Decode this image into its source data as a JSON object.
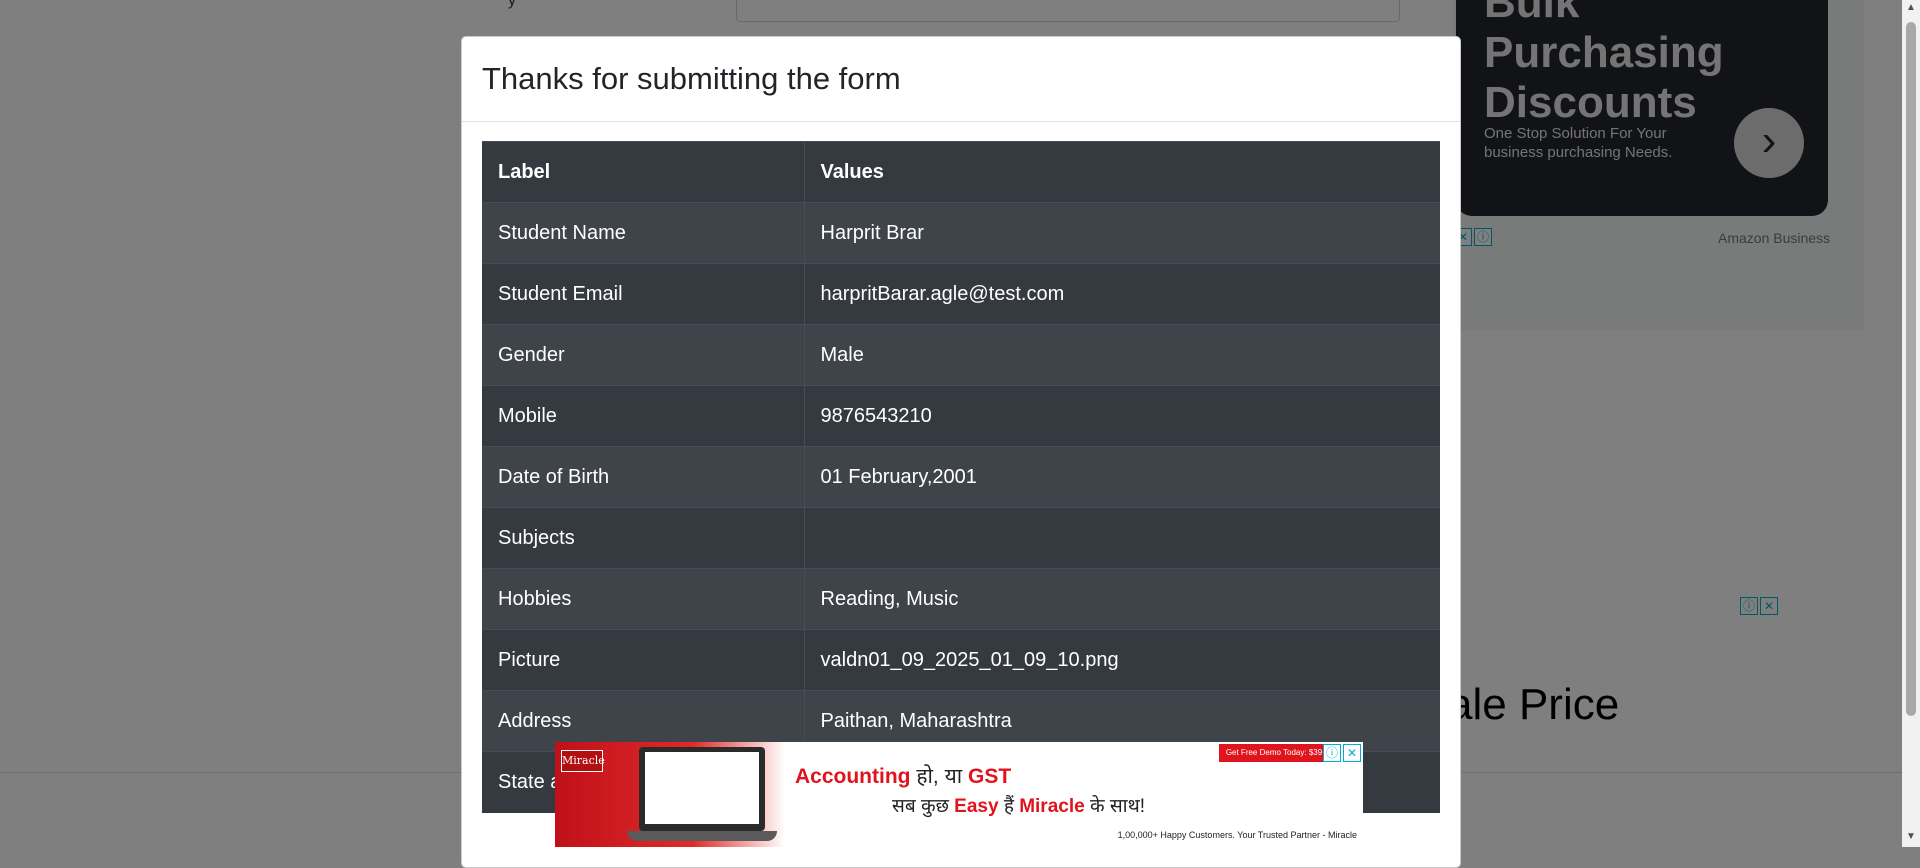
{
  "background": {
    "label_fragment": "y",
    "sale_banner": "ale Price",
    "ad_icons": [
      "ⓘ",
      "✕"
    ]
  },
  "amazon_ad": {
    "headline": "Bulk Purchasing Discounts",
    "subtext": "One Stop Solution For Your business purchasing Needs.",
    "arrow": "›",
    "brand": "Amazon Business"
  },
  "modal": {
    "title": "Thanks for submitting the form",
    "table": {
      "headers": [
        "Label",
        "Values"
      ],
      "rows": [
        {
          "label": "Student Name",
          "value": "Harprit Brar"
        },
        {
          "label": "Student Email",
          "value": "harpritBarar.agle@test.com"
        },
        {
          "label": "Gender",
          "value": "Male"
        },
        {
          "label": "Mobile",
          "value": "9876543210"
        },
        {
          "label": "Date of Birth",
          "value": "01 February,2001"
        },
        {
          "label": "Subjects",
          "value": ""
        },
        {
          "label": "Hobbies",
          "value": "Reading, Music"
        },
        {
          "label": "Picture",
          "value": "valdn01_09_2025_01_09_10.png"
        },
        {
          "label": "Address",
          "value": "Paithan, Maharashtra"
        },
        {
          "label": "State a",
          "value": ""
        }
      ]
    }
  },
  "bottom_ad": {
    "brand": "Miracle",
    "line1_red": "Accounting",
    "line1_rest": " हो, या ",
    "line1_red2": "GST",
    "line2_pre": "सब कुछ ",
    "line2_red": "Easy",
    "line2_mid": " हैं ",
    "line2_red2": "Miracle",
    "line2_post": " के साथ!",
    "demo": "Get Free Demo Today: $39",
    "footer": "1,00,000+ Happy Customers. Your Trusted Partner - Miracle"
  },
  "scrollbar": {
    "up": "▲",
    "down": "▼"
  },
  "colors": {
    "table_dark": "#343a40",
    "table_stripe": "#3e444a",
    "ad_red": "#e0141c"
  }
}
